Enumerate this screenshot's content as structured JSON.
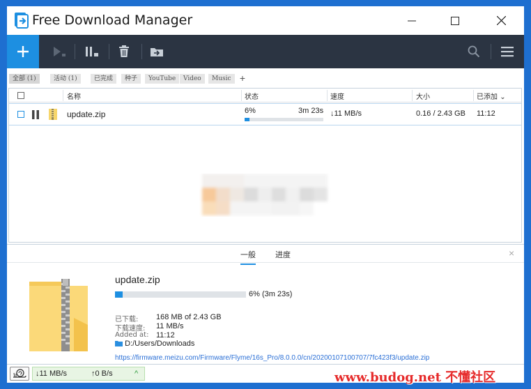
{
  "window": {
    "title": "Free Download Manager",
    "minimize_icon": "minimize-icon",
    "maximize_icon": "maximize-icon",
    "close_icon": "close-icon"
  },
  "toolbar": {
    "add_icon": "plus-icon",
    "start_icon": "play-icon",
    "pause_icon": "pause-icon",
    "delete_icon": "trash-icon",
    "move_icon": "move-icon",
    "search_icon": "search-icon",
    "menu_icon": "hamburger-menu-icon",
    "accent": "#1d8fe1",
    "bg": "#2b3442"
  },
  "tags": [
    {
      "label": "全部 (1)",
      "active": true
    },
    {
      "label": "活动 (1)"
    },
    {
      "label": "已完成"
    },
    {
      "label": "种子"
    },
    {
      "label": "YouTube"
    },
    {
      "label": "Video"
    },
    {
      "label": "Music"
    }
  ],
  "tag_add": "+",
  "list": {
    "columns": [
      "名称",
      "状态",
      "速度",
      "大小",
      "已添加"
    ],
    "sort_indicator": "⌄",
    "rows": [
      {
        "name": "update.zip",
        "status_percent": "6%",
        "time_left": "3m 23s",
        "progress": 6,
        "speed": "↓11 MB/s",
        "size": "0.16 / 2.43 GB",
        "added": "11:12"
      }
    ]
  },
  "details": {
    "tabs": [
      "一般",
      "进度"
    ],
    "close": "×",
    "file_name": "update.zip",
    "progress": 6,
    "progress_text": "6% (3m 23s)",
    "downloaded_label": "已下载:",
    "downloaded_value": "168 MB of 2.43 GB",
    "speed_label": "下载速度:",
    "speed_value": "11 MB/s",
    "added_label": "Added at:",
    "added_value": "11:12",
    "folder": "D:/Users/Downloads",
    "url": "https://firmware.meizu.com/Firmware/Flyme/16s_Pro/8.0.0.0/cn/20200107100707/7fc423f3/update.zip"
  },
  "statusbar": {
    "download_speed": "↓11 MB/s",
    "upload_speed": "↑0 B/s",
    "expand": "^"
  },
  "watermark": "www.budog.net 不懂社区"
}
